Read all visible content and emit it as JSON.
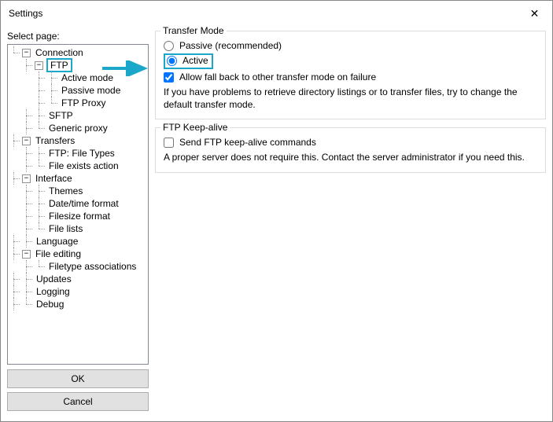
{
  "window": {
    "title": "Settings"
  },
  "left": {
    "selectLabel": "Select page:",
    "tree": {
      "connection": "Connection",
      "ftp": "FTP",
      "activeMode": "Active mode",
      "passiveMode": "Passive mode",
      "ftpProxy": "FTP Proxy",
      "sftp": "SFTP",
      "genericProxy": "Generic proxy",
      "transfers": "Transfers",
      "ftpFileTypes": "FTP: File Types",
      "fileExistsAction": "File exists action",
      "interface": "Interface",
      "themes": "Themes",
      "dateTimeFormat": "Date/time format",
      "filesizeFormat": "Filesize format",
      "fileLists": "File lists",
      "language": "Language",
      "fileEditing": "File editing",
      "filetypeAssociations": "Filetype associations",
      "updates": "Updates",
      "logging": "Logging",
      "debug": "Debug"
    },
    "okButton": "OK",
    "cancelButton": "Cancel"
  },
  "right": {
    "transferMode": {
      "title": "Transfer Mode",
      "passiveLabel": "Passive (recommended)",
      "activeLabel": "Active",
      "fallbackLabel": "Allow fall back to other transfer mode on failure",
      "description": "If you have problems to retrieve directory listings or to transfer files, try to change the default transfer mode."
    },
    "keepAlive": {
      "title": "FTP Keep-alive",
      "checkboxLabel": "Send FTP keep-alive commands",
      "description": "A proper server does not require this. Contact the server administrator if you need this."
    }
  }
}
